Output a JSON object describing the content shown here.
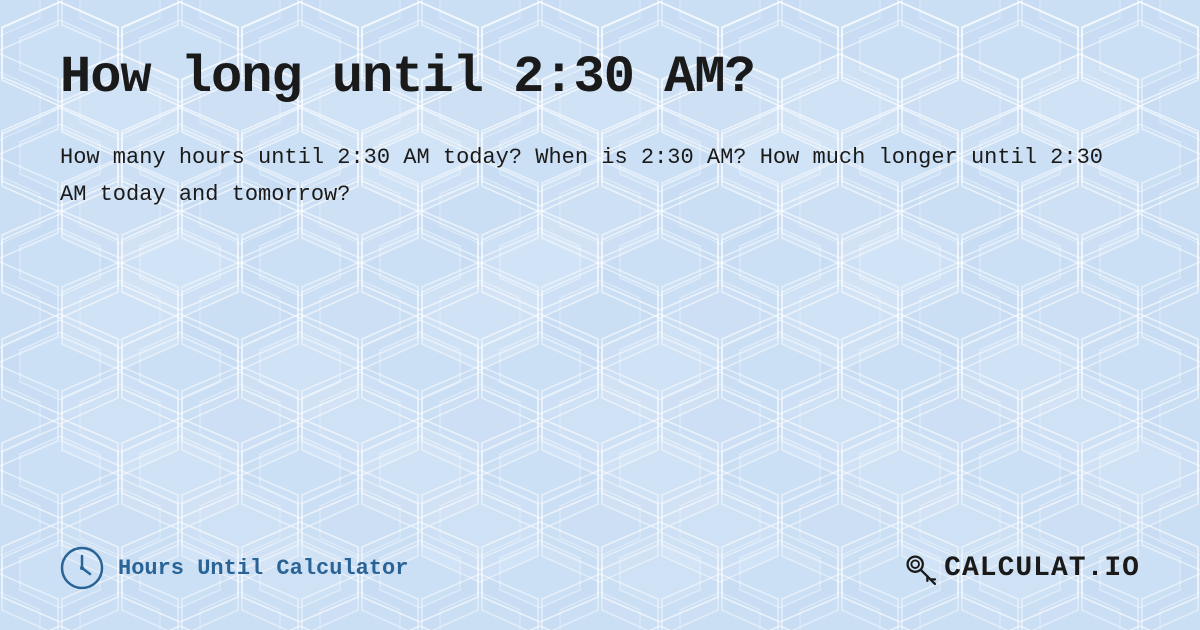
{
  "page": {
    "title": "How long until 2:30 AM?",
    "description": "How many hours until 2:30 AM today? When is 2:30 AM? How much longer until 2:30 AM today and tomorrow?",
    "background_color": "#c8dff5"
  },
  "footer": {
    "hours_calculator_label": "Hours Until Calculator",
    "logo_text": "CALCULAT.IO"
  }
}
